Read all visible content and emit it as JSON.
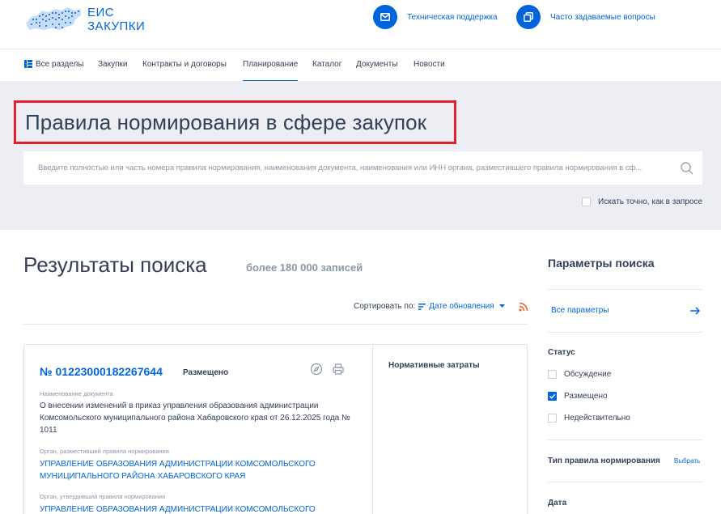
{
  "header": {
    "logo_line1": "ЕИС",
    "logo_line2": "ЗАКУПКИ",
    "support_label": "Техническая поддержка",
    "faq_label": "Часто задаваемые вопросы",
    "accent": "#0065dd"
  },
  "nav": {
    "items": [
      {
        "label": "Все разделы",
        "icon": "sections-icon"
      },
      {
        "label": "Закупки"
      },
      {
        "label": "Контракты и договоры"
      },
      {
        "label": "Планирование",
        "active": true
      },
      {
        "label": "Каталог"
      },
      {
        "label": "Документы"
      },
      {
        "label": "Новости"
      }
    ]
  },
  "banner": {
    "title": "Правила нормирования в сфере закупок",
    "search_placeholder": "Введите полностью или часть номера правила нормирования, наименования документа, наименования или ИНН органа, разместившего правила нормирования в сф...",
    "exact_label": "Искать точно, как в запросе",
    "highlight_color": "#e0202a"
  },
  "results": {
    "title": "Результаты поиска",
    "count": "более 180 000 записей",
    "sort_label": "Сортировать по:",
    "sort_value": "Дате обновления"
  },
  "card": {
    "number": "№ 01223000182267644",
    "status": "Размещено",
    "doc_name_label": "Наименование документа",
    "doc_name": "О внесении изменений в приказ управления образования администрации Комсомольского муниципального района Хабаровского края от 26.12.2025 года № 1011",
    "placed_by_label": "Орган, разместивший правила нормирования",
    "placed_by": "УПРАВЛЕНИЕ ОБРАЗОВАНИЯ АДМИНИСТРАЦИИ КОМСОМОЛЬСКОГО МУНИЦИПАЛЬНОГО РАЙОНА ХАБАРОВСКОГО КРАЯ",
    "approved_by_label": "Орган, утвердивший правила нормирования",
    "approved_by": "УПРАВЛЕНИЕ ОБРАЗОВАНИЯ АДМИНИСТРАЦИИ КОМСОМОЛЬСКОГО",
    "norm_costs": "Нормативные затраты"
  },
  "sidebar": {
    "title": "Параметры поиска",
    "all_params": "Все параметры",
    "status_title": "Статус",
    "statuses": [
      {
        "label": "Обсуждение",
        "checked": false
      },
      {
        "label": "Размещено",
        "checked": true
      },
      {
        "label": "Недействительно",
        "checked": false
      }
    ],
    "rule_type_title": "Тип правила нормирования",
    "choose": "Выбрать",
    "date_title": "Дата"
  }
}
